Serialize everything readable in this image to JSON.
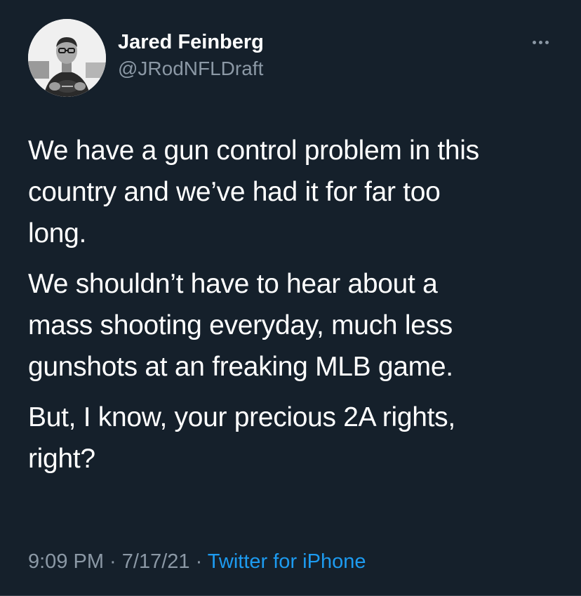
{
  "author": {
    "display_name": "Jared Feinberg",
    "handle": "@JRodNFLDraft",
    "avatar_icon": "profile-photo"
  },
  "more_icon": "more-horizontal-icon",
  "tweet": {
    "paragraphs": [
      "We have a gun control problem in this\ncountry and we’ve had it for far too\nlong.",
      "We shouldn’t have to hear about a\nmass shooting everyday, much less\ngunshots at an freaking MLB game.",
      "But, I know, your precious 2A rights,\nright?"
    ]
  },
  "meta": {
    "time": "9:09 PM",
    "separator": " · ",
    "date": "7/17/21",
    "source": "Twitter for iPhone"
  },
  "colors": {
    "background": "#15202b",
    "text": "#ffffff",
    "secondary": "#8b98a5",
    "link": "#1d9bf0"
  }
}
